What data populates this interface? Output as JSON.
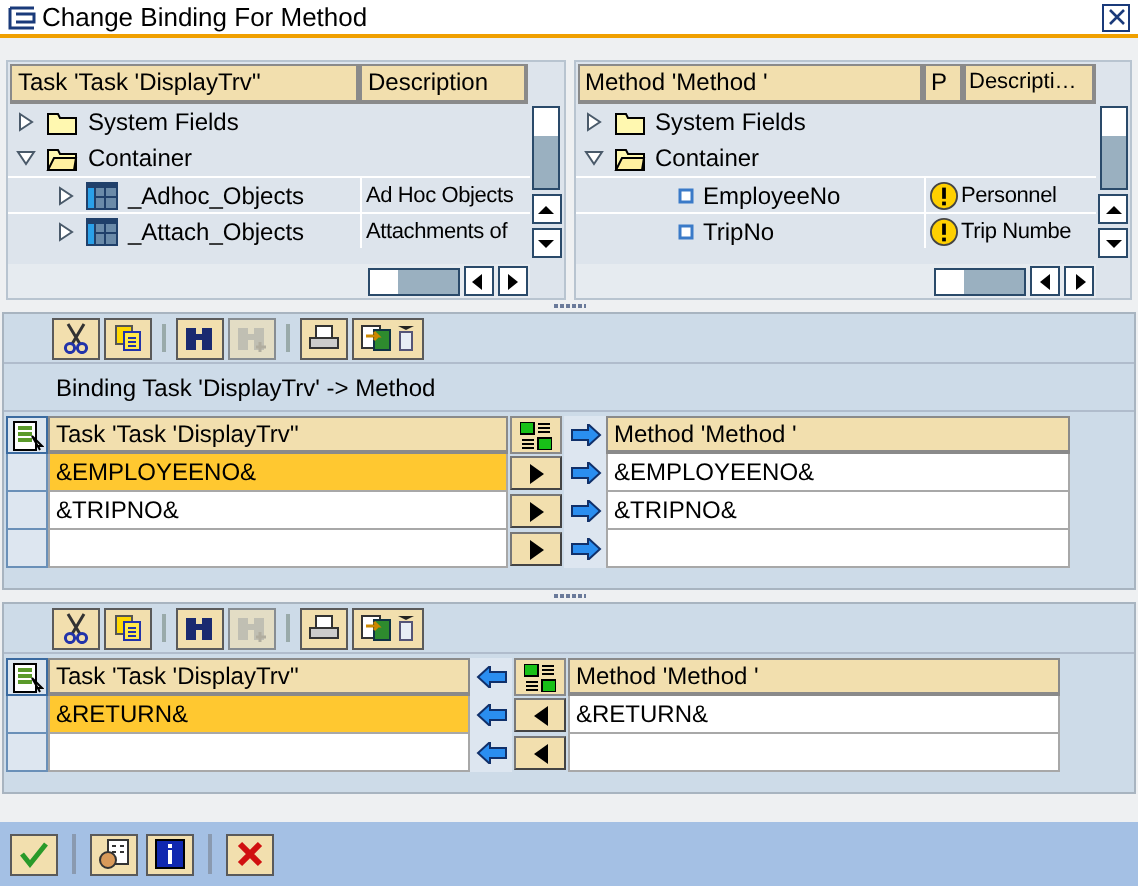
{
  "window": {
    "title": "Change Binding For Method"
  },
  "source_tree": {
    "columns": [
      "Task 'Task 'DisplayTrv''",
      "Description"
    ],
    "nodes": [
      {
        "label": "System Fields",
        "kind": "folder",
        "expanded": false
      },
      {
        "label": "Container",
        "kind": "folder",
        "expanded": true,
        "children": [
          {
            "label": "_Adhoc_Objects",
            "kind": "table",
            "expanded": false,
            "description": "Ad Hoc Objects"
          },
          {
            "label": "_Attach_Objects",
            "kind": "table",
            "expanded": false,
            "description": "Attachments of"
          }
        ]
      }
    ]
  },
  "target_tree": {
    "columns": [
      "Method 'Method '",
      "P",
      "Descripti…"
    ],
    "nodes": [
      {
        "label": "System Fields",
        "kind": "folder",
        "expanded": false
      },
      {
        "label": "Container",
        "kind": "folder",
        "expanded": true,
        "children": [
          {
            "label": "EmployeeNo",
            "kind": "element",
            "warning": true,
            "description": "Personnel"
          },
          {
            "label": "TripNo",
            "kind": "element",
            "warning": true,
            "description": "Trip Numbe"
          }
        ]
      }
    ]
  },
  "import_binding": {
    "toolbar": [
      {
        "kind": "cut",
        "disabled": false
      },
      {
        "kind": "copy",
        "disabled": false
      },
      {
        "kind": "sep"
      },
      {
        "kind": "find",
        "disabled": false
      },
      {
        "kind": "find_next",
        "disabled": true
      },
      {
        "kind": "sep"
      },
      {
        "kind": "print",
        "disabled": false
      },
      {
        "kind": "export",
        "disabled": false
      }
    ],
    "caption": "Binding Task 'DisplayTrv' -> Method",
    "kind": "import",
    "columns": [
      "Task 'Task 'DisplayTrv''",
      "Method 'Method '"
    ],
    "rows": [
      {
        "task": "&EMPLOYEENO&",
        "method": "&EMPLOYEENO&",
        "selected": true
      },
      {
        "task": "&TRIPNO&",
        "method": "&TRIPNO&",
        "selected": false
      },
      {
        "selected": false
      }
    ]
  },
  "export_binding": {
    "toolbar": [
      {
        "kind": "cut",
        "disabled": false
      },
      {
        "kind": "copy",
        "disabled": false
      },
      {
        "kind": "sep"
      },
      {
        "kind": "find",
        "disabled": false
      },
      {
        "kind": "find_next",
        "disabled": true
      },
      {
        "kind": "sep"
      },
      {
        "kind": "print",
        "disabled": false
      },
      {
        "kind": "export",
        "disabled": false
      }
    ],
    "kind": "export",
    "columns": [
      "Task 'Task 'DisplayTrv''",
      "Method 'Method '"
    ],
    "rows": [
      {
        "task": "&RETURN&",
        "method": "&RETURN&",
        "selected": true
      },
      {
        "selected": false
      }
    ]
  },
  "footer": [
    {
      "kind": "confirm"
    },
    {
      "kind": "sep"
    },
    {
      "kind": "where_used"
    },
    {
      "kind": "info"
    },
    {
      "kind": "sep"
    },
    {
      "kind": "cancel"
    }
  ]
}
